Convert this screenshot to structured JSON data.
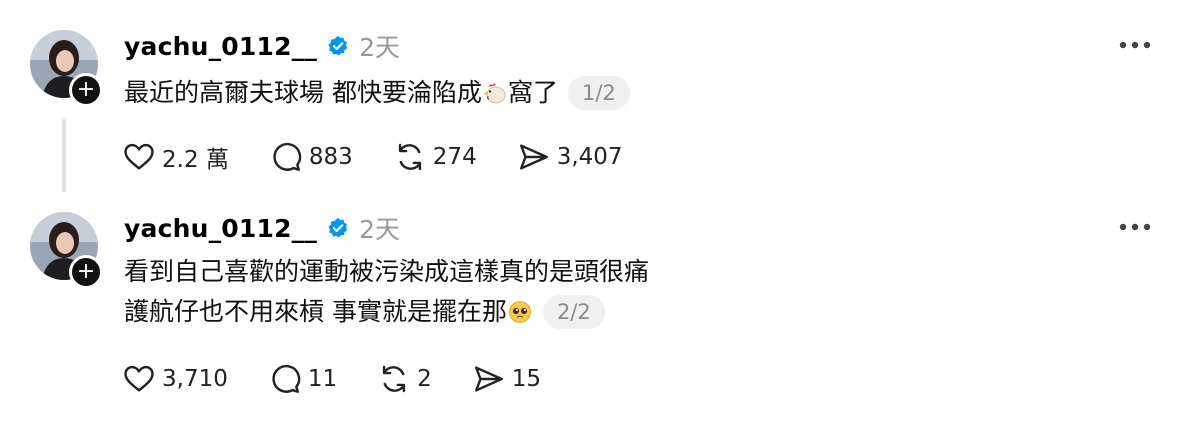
{
  "posts": [
    {
      "username": "yachu_0112__",
      "time": "2天",
      "lines": [
        "最近的高爾夫球場 都快要淪陷成",
        "窩了"
      ],
      "pager": "1/2",
      "likes": "2.2 萬",
      "replies": "883",
      "reposts": "274",
      "shares": "3,407"
    },
    {
      "username": "yachu_0112__",
      "time": "2天",
      "lines": [
        "看到自己喜歡的運動被污染成這樣真的是頭很痛",
        "護航仔也不用來槓 事實就是擺在那"
      ],
      "pager": "2/2",
      "likes": "3,710",
      "replies": "11",
      "reposts": "2",
      "shares": "15"
    }
  ],
  "colors": {
    "verified": "#0095f6",
    "secondary_text": "#999999",
    "pager_bg": "#f0f0f0"
  },
  "icons": [
    "follow-plus-icon",
    "verified-badge-icon",
    "more-icon",
    "heart-icon",
    "comment-icon",
    "repost-icon",
    "share-icon",
    "chicken-emoji-icon",
    "pleading-face-emoji-icon"
  ]
}
